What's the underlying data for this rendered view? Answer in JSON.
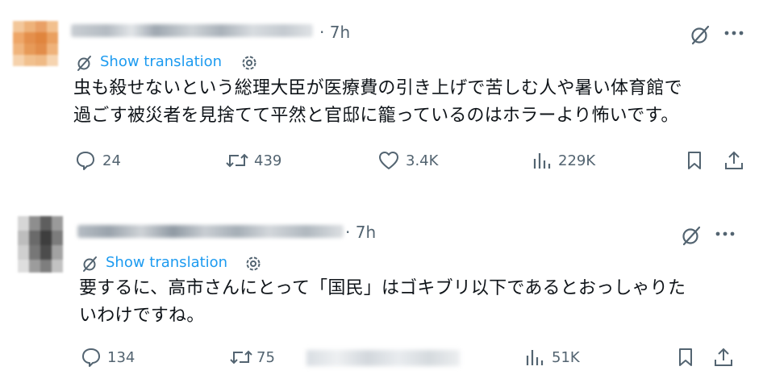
{
  "posts": [
    {
      "time": "· 7h",
      "translate_label": "Show translation",
      "lines": [
        "虫も殺せないという総理大臣が医療費の引き上げで苦しむ人や暑い体育館で",
        "過ごす被災者を見捨てて平然と官邸に籠っているのはホラーより怖いです。"
      ],
      "replies": "24",
      "reposts": "439",
      "likes": "3.4K",
      "views": "229K"
    },
    {
      "time": "· 7h",
      "translate_label": "Show translation",
      "lines": [
        "要するに、高市さんにとって「国民」はゴキブリ以下であるとおっしゃりた",
        "いわけですね。"
      ],
      "replies": "134",
      "reposts": "75",
      "views": "51K"
    }
  ],
  "icons": {
    "grok": "grok-slash-icon",
    "more": "more-dots-icon",
    "translate": "translate-slash-icon",
    "gear": "gear-icon",
    "reply": "reply-bubble-icon",
    "repost": "repost-arrows-icon",
    "like": "heart-icon",
    "views": "views-bars-icon",
    "bookmark": "bookmark-icon",
    "share": "share-icon"
  },
  "colors": {
    "text": "#0f1419",
    "muted": "#536471",
    "link": "#1d9bf0"
  }
}
